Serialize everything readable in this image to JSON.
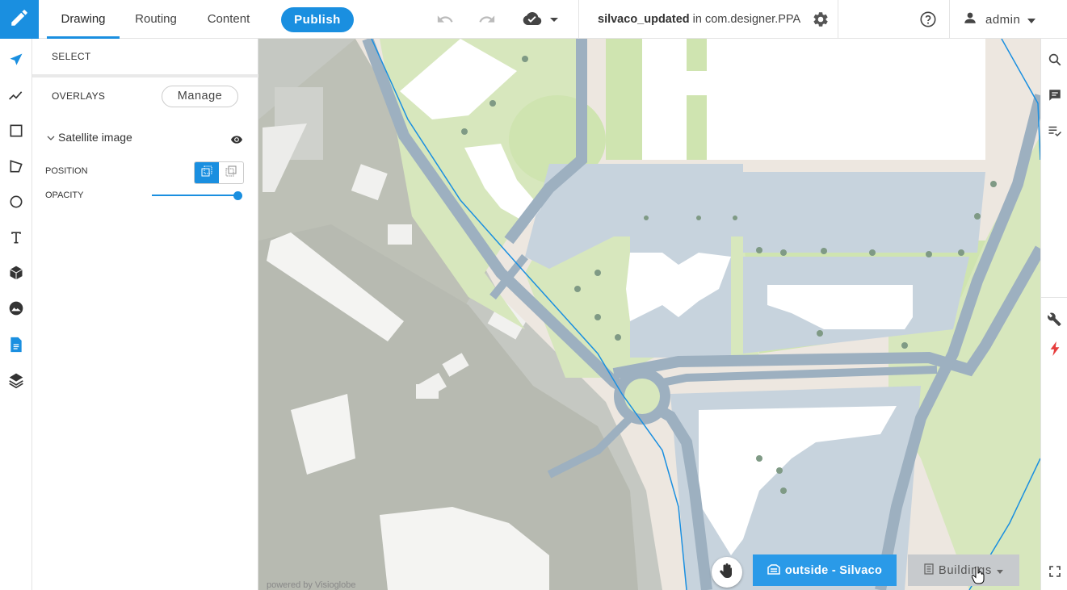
{
  "header": {
    "tabs": [
      {
        "label": "Drawing",
        "active": true
      },
      {
        "label": "Routing",
        "active": false
      },
      {
        "label": "Content",
        "active": false
      }
    ],
    "publish_label": "Publish",
    "project_name": "silvaco_updated",
    "project_in": " in ",
    "project_package": "com.designer.PPA",
    "user": "admin",
    "icons": [
      "pencil-icon",
      "undo-icon",
      "redo-icon",
      "cloud-check-icon",
      "gear-icon",
      "help-icon",
      "user-icon"
    ]
  },
  "left_rail": {
    "tools": [
      "select-arrow-icon",
      "polyline-icon",
      "rectangle-icon",
      "polygon-icon",
      "circle-icon",
      "text-icon",
      "cube-icon",
      "image-icon",
      "document-icon",
      "layers-icon"
    ]
  },
  "panel": {
    "select_label": "SELECT",
    "overlays_label": "OVERLAYS",
    "manage_label": "Manage",
    "overlay_name": "Satellite image",
    "position_label": "POSITION",
    "opacity_label": "OPACITY",
    "opacity_value": 1.0
  },
  "map": {
    "floor_button": "outside - Silvaco",
    "buildings_button": "Buildings",
    "credit": "powered by Visioglobe"
  },
  "right_rail": {
    "tools": [
      "search-icon",
      "comment-icon",
      "checklist-icon",
      "tools-icon",
      "lightning-icon",
      "fullscreen-icon"
    ]
  },
  "colors": {
    "accent": "#1a8fe0",
    "road": "#9fb3c4",
    "grass": "#d8e8c0",
    "building": "#ffffff"
  }
}
